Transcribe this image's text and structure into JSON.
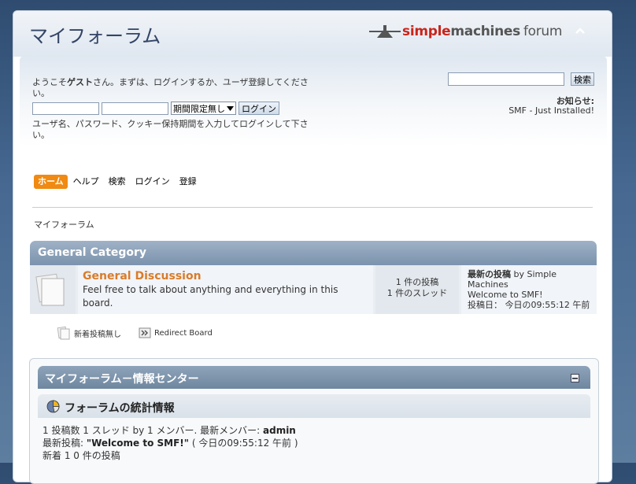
{
  "header": {
    "forum_title": "マイフォーラム",
    "logo_simple": "simple",
    "logo_machines": "machines",
    "logo_forum": "forum"
  },
  "user": {
    "welcome_pre": "ようこそ",
    "welcome_guest": "ゲスト",
    "welcome_post": "さん。まずは、ログインするか、ユーザ登録してください。",
    "username_value": "",
    "password_value": "",
    "session_select": "期間限定無し",
    "login_button": "ログイン",
    "login_hint": "ユーザ名、パスワード、クッキー保持期間を入力してログインして下さい。"
  },
  "search": {
    "input_value": "",
    "button": "検索"
  },
  "news": {
    "label": "お知らせ:",
    "text": "SMF - Just Installed!"
  },
  "menu": {
    "items": [
      {
        "label": "ホーム",
        "active": true
      },
      {
        "label": "ヘルプ"
      },
      {
        "label": "検索"
      },
      {
        "label": "ログイン"
      },
      {
        "label": "登録"
      }
    ]
  },
  "breadcrumb": "マイフォーラム",
  "category": {
    "title": "General Category",
    "board": {
      "name": "General Discussion",
      "description": "Feel free to talk about anything and everything in this board.",
      "posts": "1 件の投稿",
      "topics": "1 件のスレッド",
      "last_post_label": "最新の投稿",
      "last_post_by": "by Simple Machines",
      "last_post_subject": "Welcome to SMF!",
      "last_post_date": "投稿日： 今日の09:55:12 午前"
    }
  },
  "legend": {
    "no_new": "新着投稿無し",
    "redirect": "Redirect Board"
  },
  "info_center": {
    "title": "マイフォーラム－情報センター",
    "stats_title": "フォーラムの統計情報",
    "line1_pre": "1 投稿数 1 スレッド by 1 メンバー. 最新メンバー: ",
    "line1_member": "admin",
    "line2_pre": "最新投稿: ",
    "line2_subject": "\"Welcome to SMF!\"",
    "line2_post": " ( 今日の09:55:12 午前 )",
    "line3": "新着 1 0 件の投稿"
  },
  "colors": {
    "accent_orange": "#f08a12",
    "board_link": "#d97c2a",
    "title_blue": "#334466"
  }
}
